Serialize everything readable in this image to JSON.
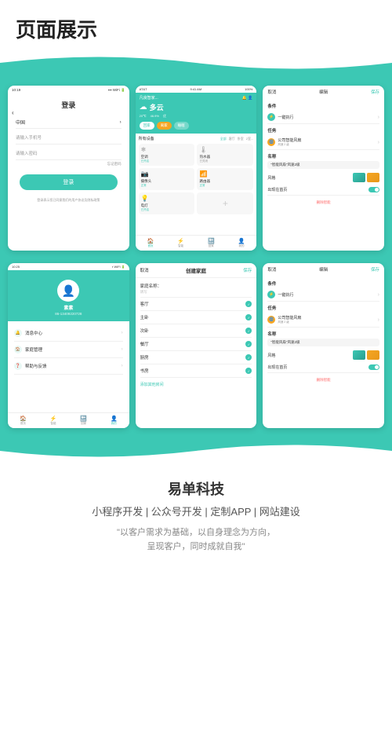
{
  "header": {
    "title": "页面展示"
  },
  "screens": {
    "screen1": {
      "time": "10:19",
      "title": "登录",
      "country": "中国",
      "phone_placeholder": "请输入手机号",
      "password_placeholder": "请输入密码",
      "forgot": "忘记密码",
      "login_btn": "登录",
      "terms": "登录表示您已同意我们的用户协议及隐私政策"
    },
    "screen2": {
      "time": "9:41 AM",
      "carrier": "AT&T",
      "battery": "100%",
      "location": "凡良智家...",
      "weather_type": "多云",
      "temp": "20℃",
      "humidity": "46.9%",
      "wind": "优",
      "tabs": [
        "回家",
        "离家",
        "睡眠"
      ],
      "section_title": "所有设备",
      "filters": [
        "全部",
        "客厅",
        "卧室",
        "厨房",
        "2室..."
      ],
      "devices": [
        {
          "name": "空调",
          "status": "已开启",
          "icon": "❄"
        },
        {
          "name": "热水器",
          "status": "已关闭",
          "icon": "🔥"
        },
        {
          "name": "摄像头",
          "status": "正常",
          "icon": "📷"
        },
        {
          "name": "路由器",
          "status": "正常",
          "icon": "📶"
        },
        {
          "name": "电灯",
          "status": "已开启",
          "icon": "💡"
        }
      ],
      "nav": [
        "首页",
        "智能",
        "回家",
        "我的"
      ]
    },
    "screen3": {
      "cancel": "取消",
      "edit": "编辑",
      "save": "保存",
      "condition_title": "条件",
      "condition_item": "一键执行",
      "task_title": "任务",
      "task_item": "公司智能风扇",
      "task_sub": "风速 2 级",
      "name_title": "名称",
      "name_value": "\"智能风扇\"风速2级",
      "style_title": "风格",
      "show_home": "出现在首页",
      "delete": "删除智能"
    },
    "screen4": {
      "time": "10:25",
      "avatar_icon": "👤",
      "name": "素素",
      "phone": "86-13409220728",
      "menu_items": [
        {
          "icon": "🔔",
          "label": "消息中心"
        },
        {
          "icon": "🏠",
          "label": "家庭管理"
        },
        {
          "icon": "❓",
          "label": "帮助与反馈"
        }
      ],
      "nav": [
        "首页",
        "智能",
        "回家",
        "我的"
      ]
    },
    "screen5": {
      "cancel": "取消",
      "title": "创建家庭",
      "save": "保存",
      "field_label": "家庭名称：",
      "field_hint": "请写",
      "rooms": [
        "客厅",
        "主卧",
        "次卧",
        "餐厅",
        "厨房",
        "书房"
      ],
      "add_room": "添加其他房间"
    },
    "screen6": {
      "cancel": "取消",
      "edit": "编辑",
      "save": "保存",
      "condition_title": "条件",
      "condition_item": "一键执行",
      "task_title": "任务",
      "task_item": "公司智能风扇",
      "task_sub": "风速 2 级",
      "name_title": "名称",
      "name_value": "\"智能风扇\"风速2级",
      "style_title": "风格",
      "show_home": "出现在首页",
      "delete": "删除智能"
    }
  },
  "footer": {
    "company": "易单科技",
    "services": "小程序开发 | 公众号开发 | 定制APP | 网站建设",
    "slogan_line1": "\"以客户需求为基础，以自身理念为方向，",
    "slogan_line2": "呈现客户，同时成就自我\""
  }
}
